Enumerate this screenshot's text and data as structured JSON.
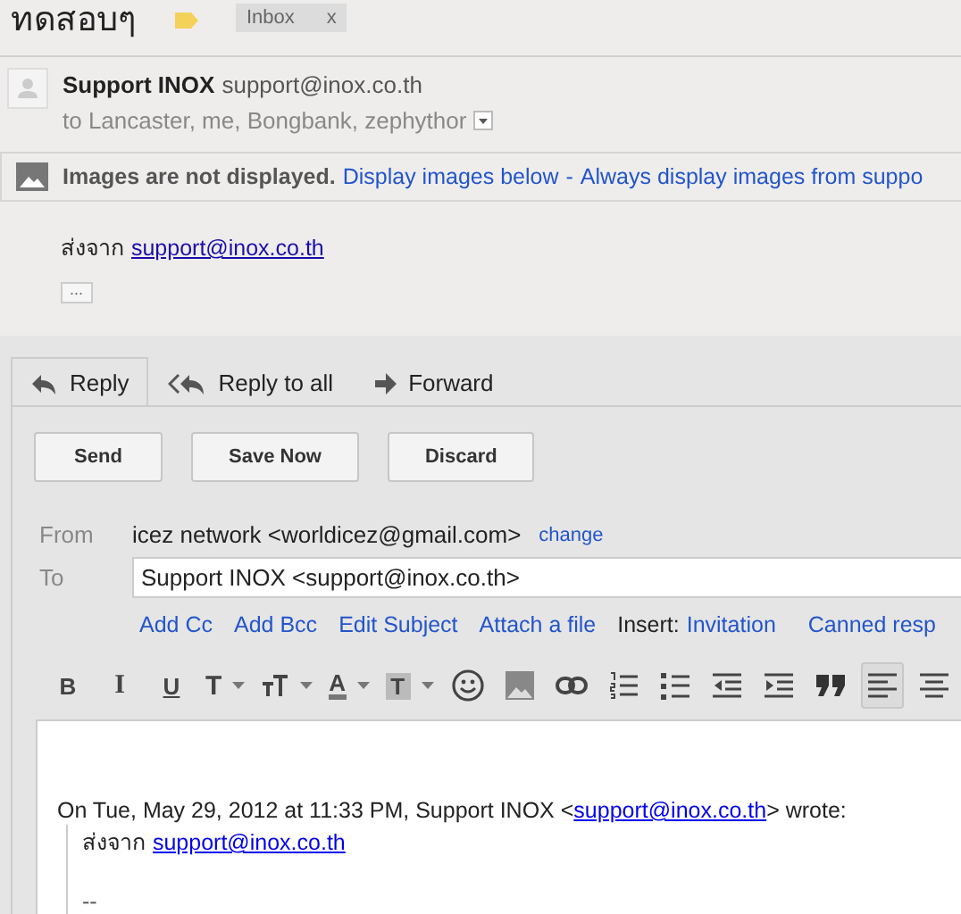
{
  "subject": "ทดสอบๆ",
  "labels": [
    {
      "text": "Inbox",
      "close": "x"
    }
  ],
  "message": {
    "sender_name": "Support INOX",
    "sender_email": "support@inox.co.th",
    "recipients": "to Lancaster, me, Bongbank, zephythor"
  },
  "images_bar": {
    "message": "Images are not displayed.",
    "links": [
      "Display images below",
      "Always display images from suppo"
    ],
    "separator": "-"
  },
  "body": {
    "prefix": "ส่งจาก",
    "link": "support@inox.co.th",
    "more": "..."
  },
  "reply_tabs": [
    {
      "kind": "reply",
      "label": "Reply",
      "selected": true
    },
    {
      "kind": "reply-all",
      "label": "Reply to all",
      "selected": false
    },
    {
      "kind": "forward",
      "label": "Forward",
      "selected": false
    }
  ],
  "buttons": [
    "Send",
    "Save Now",
    "Discard"
  ],
  "from": {
    "label": "From",
    "value": "icez network <worldicez@gmail.com>",
    "action": "change"
  },
  "to": {
    "label": "To",
    "value": "Support INOX <support@inox.co.th>"
  },
  "compose_links": [
    "Add Cc",
    "Add Bcc",
    "Edit Subject",
    "Attach a file"
  ],
  "insert": {
    "label": "Insert:",
    "links": [
      "Invitation",
      "Canned resp"
    ]
  },
  "toolbar": [
    {
      "kind": "bold",
      "glyph": "B",
      "dropdown": false,
      "selected": false
    },
    {
      "kind": "italic",
      "glyph": "I",
      "dropdown": false,
      "selected": false
    },
    {
      "kind": "underline",
      "glyph": "U",
      "dropdown": false,
      "selected": false
    },
    {
      "kind": "font",
      "glyph": "T",
      "dropdown": true,
      "selected": false
    },
    {
      "kind": "size",
      "dropdown": true,
      "selected": false
    },
    {
      "kind": "text-color",
      "glyph": "A",
      "dropdown": true,
      "selected": false
    },
    {
      "kind": "highlight",
      "glyph": "T",
      "dropdown": true,
      "selected": false
    },
    {
      "kind": "emoji",
      "dropdown": false,
      "selected": false
    },
    {
      "kind": "image",
      "dropdown": false,
      "selected": false
    },
    {
      "kind": "link",
      "dropdown": false,
      "selected": false
    },
    {
      "kind": "numbered-list",
      "dropdown": false,
      "selected": false
    },
    {
      "kind": "bullet-list",
      "dropdown": false,
      "selected": false
    },
    {
      "kind": "indent-less",
      "dropdown": false,
      "selected": false
    },
    {
      "kind": "indent-more",
      "dropdown": false,
      "selected": false
    },
    {
      "kind": "quote",
      "dropdown": false,
      "selected": false
    },
    {
      "kind": "align-left",
      "dropdown": false,
      "selected": true
    },
    {
      "kind": "align-center",
      "dropdown": false,
      "selected": false
    }
  ],
  "editor": {
    "attribution_before": "On Tue, May 29, 2012 at 11:33 PM, Support INOX <",
    "attribution_link": "support@inox.co.th",
    "attribution_after": "> wrote:",
    "quote_prefix": "ส่งจาก",
    "quote_link": "support@inox.co.th",
    "signature": "--"
  }
}
